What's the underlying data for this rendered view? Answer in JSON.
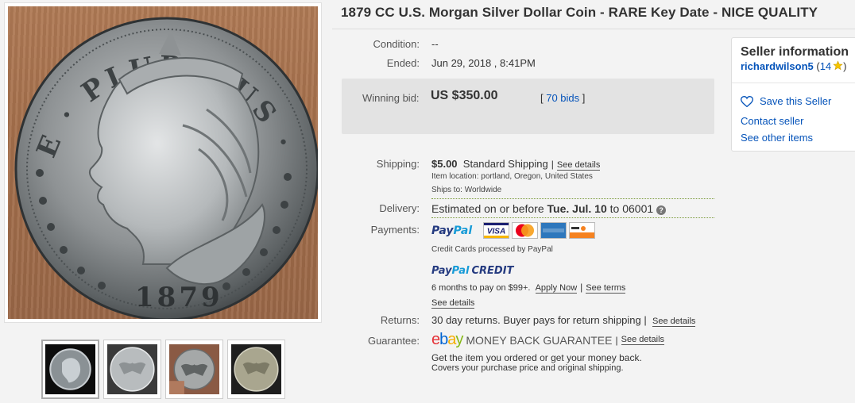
{
  "listing": {
    "title": "1879 CC U.S. Morgan Silver Dollar Coin - RARE Key Date - NICE QUALITY"
  },
  "gallery": {
    "main_image": "morgan-dollar-obverse-photo",
    "coin_legend": "E · PLURIBUS · UNUM",
    "coin_year": "1879",
    "thumbnails": [
      "morgan-obverse-black-bg",
      "morgan-reverse-eagle",
      "morgan-reverse-in-hand",
      "morgan-reverse-dark"
    ]
  },
  "details": {
    "condition_label": "Condition:",
    "condition_value": "--",
    "ended_label": "Ended:",
    "ended_value": "Jun 29, 2018 , 8:41PM",
    "winning_bid_label": "Winning bid:",
    "winning_bid_value": "US $350.00",
    "bids_open": "[ ",
    "bids_count": "70 bids",
    "bids_close": " ]",
    "shipping_label": "Shipping:",
    "shipping_cost": "$5.00",
    "shipping_method": "Standard Shipping",
    "shipping_sep": "|",
    "see_details": "See details",
    "item_location": "Item location:  portland, Oregon, United States",
    "ships_to": "Ships to:  Worldwide",
    "delivery_label": "Delivery:",
    "delivery_prefix": "Estimated on or before ",
    "delivery_date": "Tue. Jul. 10",
    "delivery_suffix": " to 06001",
    "help_glyph": "?",
    "payments_label": "Payments:",
    "paypal_pay": "Pay",
    "paypal_pal": "Pal",
    "cards": [
      "visa-card",
      "mastercard-card",
      "amex-card",
      "discover-card"
    ],
    "credit_cards_note": "Credit Cards processed by PayPal",
    "paypal_credit_word": "CREDIT",
    "credit_offer": "6 months to pay on $99+.",
    "apply_now": "Apply Now",
    "see_terms": "See terms",
    "returns_label": "Returns:",
    "returns_value": "30 day returns. Buyer pays for return shipping |",
    "guarantee_label": "Guarantee:",
    "guarantee_title": "MONEY BACK GUARANTEE",
    "guarantee_line1": "Get the item you ordered or get your money back.",
    "guarantee_line2": "Covers your purchase price and original shipping."
  },
  "ebay_logo": {
    "e": "e",
    "b": "b",
    "a": "a",
    "y": "y"
  },
  "seller": {
    "heading": "Seller information",
    "username": "richardwilson5",
    "feedback_open": " (",
    "feedback_score": "14",
    "feedback_close": ")",
    "save_seller": "Save this Seller",
    "contact_seller": "Contact seller",
    "other_items": "See other items"
  },
  "colors": {
    "link": "#0654ba",
    "bid_box": "#e3e3e3",
    "star": "#f5c400",
    "paypal_dark": "#253b80",
    "paypal_light": "#179bd7"
  }
}
